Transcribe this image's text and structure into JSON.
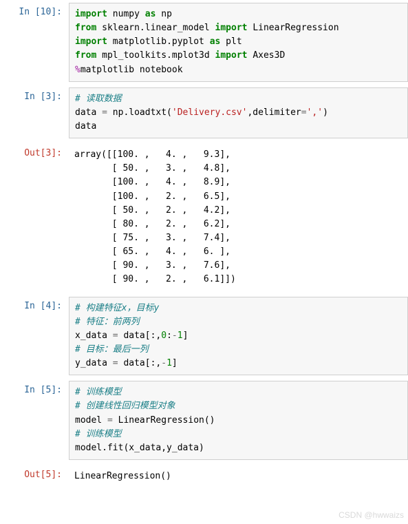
{
  "cells": {
    "c10": {
      "prompt": "In [10]:",
      "lines": [
        [
          {
            "t": "import ",
            "c": "kw"
          },
          {
            "t": "numpy "
          },
          {
            "t": "as ",
            "c": "kw"
          },
          {
            "t": "np"
          }
        ],
        [
          {
            "t": "from ",
            "c": "kw"
          },
          {
            "t": "sklearn.linear_model "
          },
          {
            "t": "import ",
            "c": "kw"
          },
          {
            "t": "LinearRegression"
          }
        ],
        [
          {
            "t": "import ",
            "c": "kw"
          },
          {
            "t": "matplotlib.pyplot "
          },
          {
            "t": "as ",
            "c": "kw"
          },
          {
            "t": "plt"
          }
        ],
        [
          {
            "t": "from ",
            "c": "kw"
          },
          {
            "t": "mpl_toolkits.mplot3d "
          },
          {
            "t": "import ",
            "c": "kw"
          },
          {
            "t": "Axes3D"
          }
        ],
        [
          {
            "t": "%",
            "c": "mag"
          },
          {
            "t": "matplotlib notebook"
          }
        ]
      ]
    },
    "c3": {
      "prompt": "In  [3]:",
      "lines": [
        [
          {
            "t": "# 读取数据",
            "c": "cm"
          }
        ],
        [
          {
            "t": "data "
          },
          {
            "t": "=",
            "c": "op"
          },
          {
            "t": " np.loadtxt("
          },
          {
            "t": "'Delivery.csv'",
            "c": "str"
          },
          {
            "t": ",delimiter"
          },
          {
            "t": "=",
            "c": "op"
          },
          {
            "t": "','",
            "c": "str"
          },
          {
            "t": ")"
          }
        ],
        [
          {
            "t": "data"
          }
        ]
      ]
    },
    "o3": {
      "prompt": "Out[3]:",
      "text": "array([[100. ,   4. ,   9.3],\n       [ 50. ,   3. ,   4.8],\n       [100. ,   4. ,   8.9],\n       [100. ,   2. ,   6.5],\n       [ 50. ,   2. ,   4.2],\n       [ 80. ,   2. ,   6.2],\n       [ 75. ,   3. ,   7.4],\n       [ 65. ,   4. ,   6. ],\n       [ 90. ,   3. ,   7.6],\n       [ 90. ,   2. ,   6.1]])"
    },
    "c4": {
      "prompt": "In  [4]:",
      "lines": [
        [
          {
            "t": "# 构建特征x，目标y",
            "c": "cm"
          }
        ],
        [
          {
            "t": "# 特征：前两列",
            "c": "cm"
          }
        ],
        [
          {
            "t": "x_data "
          },
          {
            "t": "=",
            "c": "op"
          },
          {
            "t": " data[:,"
          },
          {
            "t": "0",
            "c": "num"
          },
          {
            "t": ":"
          },
          {
            "t": "-",
            "c": "op"
          },
          {
            "t": "1",
            "c": "num"
          },
          {
            "t": "]"
          }
        ],
        [
          {
            "t": "# 目标：最后一列",
            "c": "cm"
          }
        ],
        [
          {
            "t": "y_data "
          },
          {
            "t": "=",
            "c": "op"
          },
          {
            "t": " data[:,"
          },
          {
            "t": "-",
            "c": "op"
          },
          {
            "t": "1",
            "c": "num"
          },
          {
            "t": "]"
          }
        ]
      ]
    },
    "c5": {
      "prompt": "In  [5]:",
      "lines": [
        [
          {
            "t": "# 训练模型",
            "c": "cm"
          }
        ],
        [
          {
            "t": "# 创建线性回归模型对象",
            "c": "cm"
          }
        ],
        [
          {
            "t": "model "
          },
          {
            "t": "=",
            "c": "op"
          },
          {
            "t": " LinearRegression()"
          }
        ],
        [
          {
            "t": "# 训练模型",
            "c": "cm"
          }
        ],
        [
          {
            "t": "model.fit(x_data,y_data)"
          }
        ]
      ]
    },
    "o5": {
      "prompt": "Out[5]:",
      "text": "LinearRegression()"
    }
  },
  "watermark": "CSDN @hwwaizs"
}
